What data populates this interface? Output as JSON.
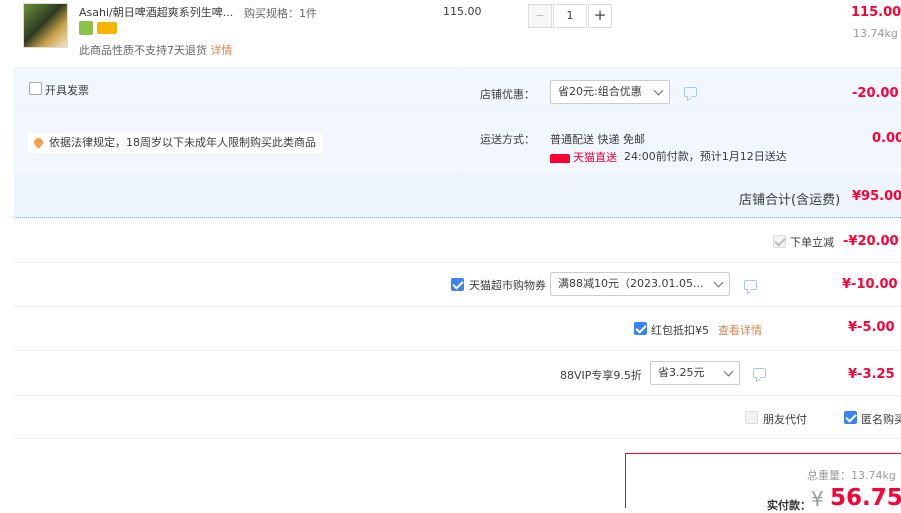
{
  "item": {
    "title": "Asahi/朝日啤酒超爽系列生啤...",
    "spec_label": "购买规格：1件",
    "unit_price": "115.00",
    "quantity": "1",
    "minus": "−",
    "plus": "+",
    "subtotal": "115.00",
    "weight": "13.74kg",
    "return_note": "此商品性质不支持7天退货",
    "return_link": "详情"
  },
  "invoice": {
    "label": "开具发票"
  },
  "legal_notice": "依据法律规定，18周岁以下未成年人限制购买此类商品",
  "shop_discount": {
    "label": "店铺优惠：",
    "selected": "省20元:组合优惠",
    "amount": "-20.00"
  },
  "shipping": {
    "label": "运送方式：",
    "method": "普通配送 快递 免邮",
    "badge": "天猫直送",
    "eta": "24:00前付款，预计1月12日送达",
    "amount": "0.00"
  },
  "shop_total": {
    "label": "店铺合计(含运费)",
    "amount": "¥95.00"
  },
  "order_discount": {
    "label": "下单立减",
    "amount": "-¥20.00"
  },
  "coupon": {
    "label": "天猫超市购物券",
    "selected": "满88减10元（2023.01.05...",
    "amount": "¥-10.00"
  },
  "redpacket": {
    "label": "红包抵扣¥5",
    "link": "查看详情",
    "amount": "¥-5.00"
  },
  "vip": {
    "label": "88VIP专享9.5折",
    "selected": "省3.25元",
    "amount": "¥-3.25"
  },
  "options": {
    "friend_pay": "朋友代付",
    "anonymous": "匿名购买"
  },
  "summary": {
    "weight": "总重量：13.74kg",
    "pay_label": "实付款：",
    "currency": "¥",
    "pay_amount": "56.75"
  },
  "colors": {
    "accent_red": "#ff0036",
    "link_orange": "#d78854",
    "panel_blue": "#eef4fb",
    "checkbox_blue": "#3b82f6"
  }
}
